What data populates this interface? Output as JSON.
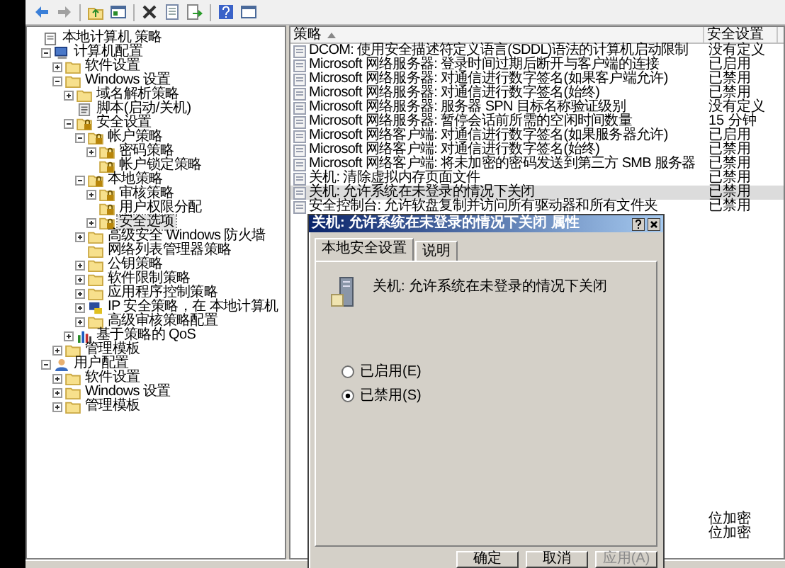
{
  "tree": {
    "items": [
      {
        "label": "本地计算机 策略",
        "kind": "document",
        "selected": false,
        "children": [
          {
            "label": "计算机配置",
            "kind": "computer",
            "expanded": true,
            "selected": false,
            "children": [
              {
                "label": "软件设置",
                "kind": "folder",
                "expanded": false,
                "selected": false
              },
              {
                "label": "Windows 设置",
                "kind": "folder",
                "expanded": true,
                "selected": false,
                "children": [
                  {
                    "label": "域名解析策略",
                    "kind": "folder",
                    "expanded": false,
                    "selected": false
                  },
                  {
                    "label": "脚本(启动/关机)",
                    "kind": "script",
                    "selected": false
                  },
                  {
                    "label": "安全设置",
                    "kind": "secure",
                    "expanded": true,
                    "selected": false,
                    "children": [
                      {
                        "label": "帐户策略",
                        "kind": "secure",
                        "expanded": true,
                        "selected": false,
                        "children": [
                          {
                            "label": "密码策略",
                            "kind": "secure",
                            "expanded": false,
                            "selected": false
                          },
                          {
                            "label": "帐户锁定策略",
                            "kind": "secure",
                            "selected": false
                          }
                        ]
                      },
                      {
                        "label": "本地策略",
                        "kind": "secure",
                        "expanded": true,
                        "selected": false,
                        "children": [
                          {
                            "label": "审核策略",
                            "kind": "secure",
                            "expanded": false,
                            "selected": false
                          },
                          {
                            "label": "用户权限分配",
                            "kind": "secure",
                            "selected": false
                          },
                          {
                            "label": "安全选项",
                            "kind": "secure",
                            "expanded": false,
                            "selected": true
                          }
                        ]
                      },
                      {
                        "label": "高级安全 Windows 防火墙",
                        "kind": "folder",
                        "expanded": false,
                        "selected": false
                      },
                      {
                        "label": "网络列表管理器策略",
                        "kind": "folder",
                        "selected": false
                      },
                      {
                        "label": "公钥策略",
                        "kind": "folder",
                        "expanded": false,
                        "selected": false
                      },
                      {
                        "label": "软件限制策略",
                        "kind": "folder",
                        "expanded": false,
                        "selected": false
                      },
                      {
                        "label": "应用程序控制策略",
                        "kind": "folder",
                        "expanded": false,
                        "selected": false
                      },
                      {
                        "label": "IP 安全策略，在 本地计算机",
                        "kind": "network",
                        "expanded": false,
                        "selected": false
                      },
                      {
                        "label": "高级审核策略配置",
                        "kind": "folder",
                        "expanded": false,
                        "selected": false
                      }
                    ]
                  },
                  {
                    "label": "基于策略的 QoS",
                    "kind": "chart",
                    "expanded": false,
                    "selected": false
                  }
                ]
              },
              {
                "label": "管理模板",
                "kind": "folder",
                "expanded": false,
                "selected": false
              }
            ]
          },
          {
            "label": "用户配置",
            "kind": "user",
            "expanded": true,
            "selected": false,
            "children": [
              {
                "label": "软件设置",
                "kind": "folder",
                "expanded": false,
                "selected": false
              },
              {
                "label": "Windows 设置",
                "kind": "folder",
                "expanded": false,
                "selected": false
              },
              {
                "label": "管理模板",
                "kind": "folder",
                "expanded": false,
                "selected": false
              }
            ]
          }
        ]
      }
    ]
  },
  "policy_list": {
    "columns": [
      "策略",
      "安全设置"
    ],
    "rows": [
      {
        "policy": "DCOM: 使用安全描述符定义语言(SDDL)语法的计算机启动限制",
        "setting": "没有定义",
        "selected": false
      },
      {
        "policy": "Microsoft 网络服务器: 登录时间过期后断开与客户端的连接",
        "setting": "已启用",
        "selected": false
      },
      {
        "policy": "Microsoft 网络服务器: 对通信进行数字签名(如果客户端允许)",
        "setting": "已禁用",
        "selected": false
      },
      {
        "policy": "Microsoft 网络服务器: 对通信进行数字签名(始终)",
        "setting": "已禁用",
        "selected": false
      },
      {
        "policy": "Microsoft 网络服务器: 服务器 SPN 目标名称验证级别",
        "setting": "没有定义",
        "selected": false
      },
      {
        "policy": "Microsoft 网络服务器: 暂停会话前所需的空闲时间数量",
        "setting": "15 分钟",
        "selected": false
      },
      {
        "policy": "Microsoft 网络客户端: 对通信进行数字签名(如果服务器允许)",
        "setting": "已启用",
        "selected": false
      },
      {
        "policy": "Microsoft 网络客户端: 对通信进行数字签名(始终)",
        "setting": "已禁用",
        "selected": false
      },
      {
        "policy": "Microsoft 网络客户端: 将未加密的密码发送到第三方 SMB 服务器",
        "setting": "已禁用",
        "selected": false
      },
      {
        "policy": "关机: 清除虚拟内存页面文件",
        "setting": "已禁用",
        "selected": false
      },
      {
        "policy": "关机: 允许系统在未登录的情况下关闭",
        "setting": "已禁用",
        "selected": true
      },
      {
        "policy": "安全控制台: 允许软盘复制并访问所有驱动器和所有文件夹",
        "setting": "已禁用",
        "selected": false
      }
    ],
    "covered_rows": [
      {
        "text": "位加密"
      },
      {
        "text": "位加密"
      }
    ]
  },
  "dialog": {
    "title": "关机: 允许系统在未登录的情况下关闭 属性",
    "tabs": [
      {
        "label": "本地安全设置",
        "selected": true
      },
      {
        "label": "说明",
        "selected": false
      }
    ],
    "policy_name": "关机: 允许系统在未登录的情况下关闭",
    "options": [
      {
        "label": "已启用(E)",
        "selected": false
      },
      {
        "label": "已禁用(S)",
        "selected": true
      }
    ],
    "buttons": [
      {
        "label": "确定",
        "disabled": false
      },
      {
        "label": "取消",
        "disabled": false
      },
      {
        "label": "应用(A)",
        "disabled": true
      }
    ]
  }
}
